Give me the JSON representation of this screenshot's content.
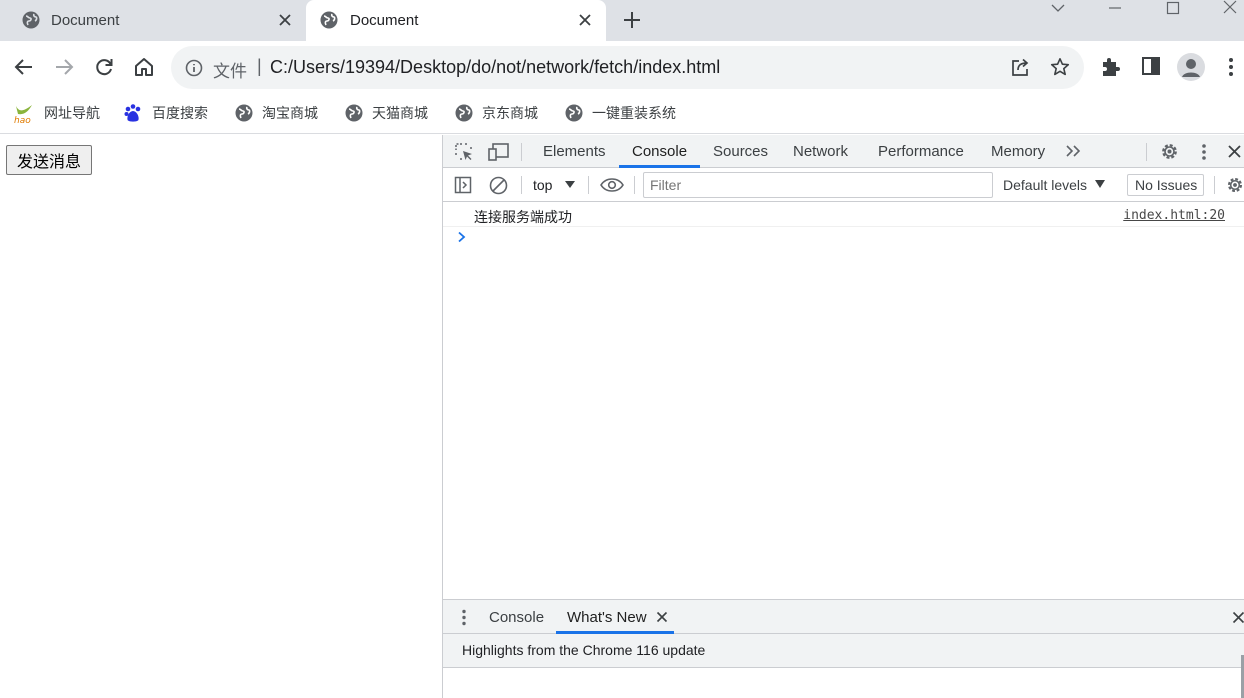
{
  "browser": {
    "tabs": [
      {
        "title": "Document",
        "active": false
      },
      {
        "title": "Document",
        "active": true
      }
    ],
    "address": {
      "scheme_label": "文件",
      "separator": "|",
      "url": "C:/Users/19394/Desktop/do/not/network/fetch/index.html"
    },
    "bookmarks": [
      {
        "label": "网址导航",
        "icon": "hao-logo-icon"
      },
      {
        "label": "百度搜索",
        "icon": "baidu-paw-icon"
      },
      {
        "label": "淘宝商城",
        "icon": "globe-icon"
      },
      {
        "label": "天猫商城",
        "icon": "globe-icon"
      },
      {
        "label": "京东商城",
        "icon": "globe-icon"
      },
      {
        "label": "一键重装系统",
        "icon": "globe-icon"
      }
    ]
  },
  "page": {
    "send_button_label": "发送消息"
  },
  "devtools": {
    "tabs": [
      "Elements",
      "Console",
      "Sources",
      "Network",
      "Performance",
      "Memory"
    ],
    "active_tab": "Console",
    "console": {
      "context": "top",
      "filter_placeholder": "Filter",
      "levels_label": "Default levels",
      "issues_label": "No Issues",
      "messages": [
        {
          "text": "连接服务端成功",
          "source": "index.html:20"
        }
      ]
    },
    "drawer": {
      "tabs": [
        "Console",
        "What's New"
      ],
      "active_tab": "What's New",
      "highlight_text": "Highlights from the Chrome 116 update"
    }
  },
  "colors": {
    "tabstrip_bg": "#dee1e6",
    "omnibox_bg": "#f1f3f4",
    "devtools_accent": "#1a73e8",
    "devtools_toolbar_bg": "#f1f3f4"
  }
}
